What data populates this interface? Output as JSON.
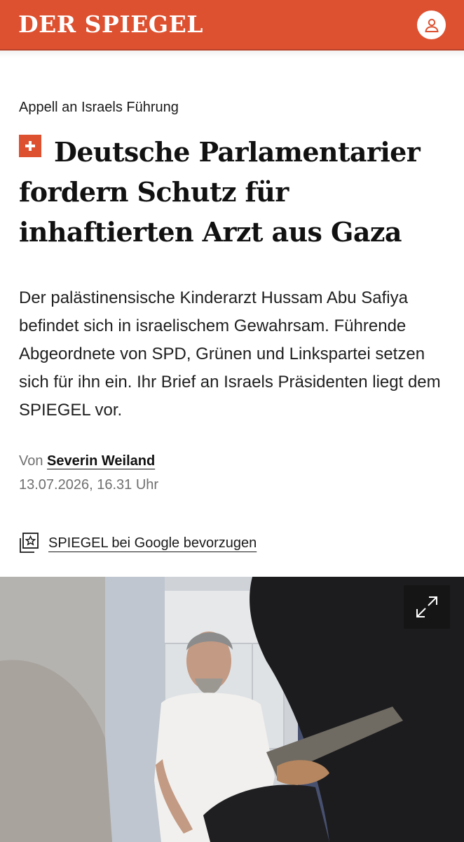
{
  "header": {
    "logo_text": "DER SPIEGEL",
    "brand_color": "#dd5030",
    "account_icon": "user-icon"
  },
  "article": {
    "kicker": "Appell an Israels Führung",
    "premium_icon": "plus-badge-icon",
    "headline": "Deutsche Parlamentarier fordern Schutz für inhaftierten Arzt aus Gaza",
    "teaser": "Der palästinensische Kinderarzt Hussam Abu Safiya befindet sich in israelischem Gewahrsam. Führende Abgeordnete von SPD, Grünen und Linkspartei setzen sich für ihn ein. Ihr Brief an Israels Präsidenten liegt dem SPIEGEL vor.",
    "byline_prefix": "Von",
    "author": "Severin Weiland",
    "date": "13.07.2026, 16.31 Uhr"
  },
  "google_pref": {
    "icon": "star-bookmark-icon",
    "label": "SPIEGEL bei Google bevorzugen"
  },
  "photo": {
    "expand_icon": "expand-icon"
  }
}
